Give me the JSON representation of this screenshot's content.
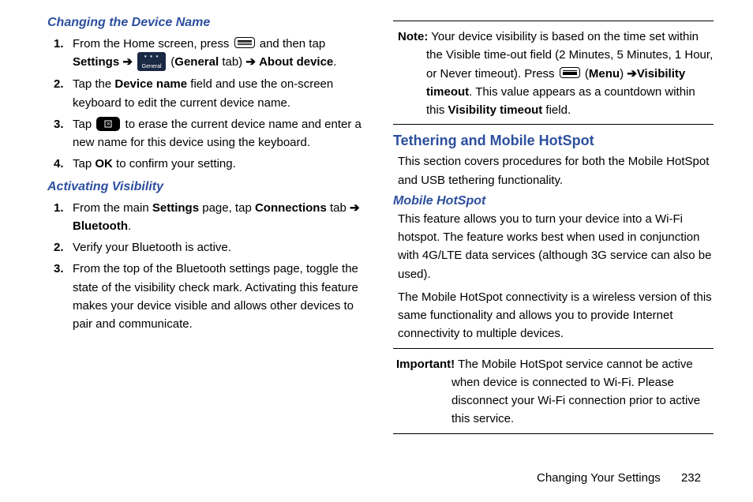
{
  "left": {
    "h1": "Changing the Device Name",
    "s1_a": "From the Home screen, press ",
    "s1_b": " and then tap ",
    "s1_settings": "Settings",
    "s1_c": " (",
    "s1_general": "General",
    "s1_tab": " tab) ",
    "s1_about": "About device",
    "s1_end": ".",
    "general_icon_label": "General",
    "s2_a": "Tap the ",
    "s2_devname": "Device name",
    "s2_b": " field and use the on-screen keyboard to edit the current device name.",
    "s3_a": "Tap ",
    "s3_b": " to erase the current device name and enter a new name for this device using the keyboard.",
    "s4_a": "Tap ",
    "s4_ok": "OK",
    "s4_b": " to confirm your setting.",
    "h2": "Activating Visibility",
    "v1_a": "From the main ",
    "v1_settings": "Settings",
    "v1_b": " page, tap ",
    "v1_conn": "Connections",
    "v1_c": " tab ",
    "v1_bt": "Bluetooth",
    "v1_end": ".",
    "v2": "Verify your Bluetooth is active.",
    "v3": "From the top of the Bluetooth settings page, toggle the state of the visibility check mark. Activating this feature makes your device visible and allows other devices to pair and communicate."
  },
  "right": {
    "note_lbl": "Note:",
    "note_a": " Your device visibility is based on the time set within the Visible time-out field (2 Minutes, 5 Minutes, 1 Hour, or Never timeout). Press ",
    "note_menu_open": " (",
    "note_menu": "Menu",
    "note_menu_close": ") ",
    "note_vt": "Visibility timeout",
    "note_b": ". This value appears as a countdown within this ",
    "note_vt2": "Visibility timeout",
    "note_c": " field.",
    "h1": "Tethering and Mobile HotSpot",
    "para1": "This section covers procedures for both the Mobile HotSpot and USB tethering functionality.",
    "h2": "Mobile HotSpot",
    "para2": "This feature allows you to turn your device into a Wi-Fi hotspot. The feature works best when used in conjunction with 4G/LTE data services (although 3G service can also be used).",
    "para3": "The Mobile HotSpot connectivity is a wireless version of this same functionality and allows you to provide Internet connectivity to multiple devices.",
    "imp_lbl": "Important!",
    "imp_text": " The Mobile HotSpot service cannot be active when device is connected to Wi-Fi. Please disconnect your Wi-Fi connection prior to active this service."
  },
  "footer": {
    "section": "Changing Your Settings",
    "page": "232"
  }
}
